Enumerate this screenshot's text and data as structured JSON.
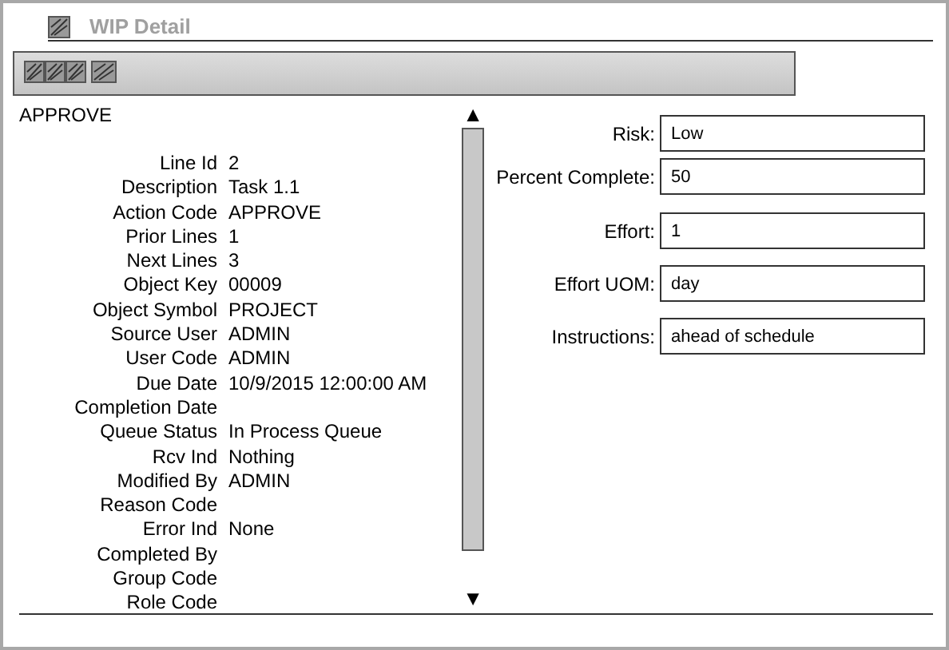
{
  "window": {
    "title": "WIP Detail"
  },
  "heading": "APPROVE",
  "details": [
    {
      "label": "Line Id",
      "value": "2"
    },
    {
      "label": "Description",
      "value": "Task 1.1"
    },
    {
      "label": "Action Code",
      "value": "APPROVE"
    },
    {
      "label": "Prior Lines",
      "value": "1"
    },
    {
      "label": "Next Lines",
      "value": "3"
    },
    {
      "label": "Object Key",
      "value": "00009"
    },
    {
      "label": "Object Symbol",
      "value": "PROJECT"
    },
    {
      "label": "Source User",
      "value": "ADMIN"
    },
    {
      "label": "User Code",
      "value": "ADMIN"
    },
    {
      "label": "Due Date",
      "value": "10/9/2015 12:00:00 AM"
    },
    {
      "label": "Completion Date"
    },
    {
      "label": "Queue Status",
      "value": "In Process Queue"
    },
    {
      "label": "Rcv Ind",
      "value": "Nothing"
    },
    {
      "label": "Modified By",
      "value": "ADMIN"
    },
    {
      "label": "Reason Code"
    },
    {
      "label": "Error Ind",
      "value": "None"
    },
    {
      "label": "Completed By"
    },
    {
      "label": "Group Code"
    },
    {
      "label": "Role Code"
    }
  ],
  "scrollbar": {
    "up": "▲",
    "down": "▼"
  },
  "fields": [
    {
      "label": "Risk:",
      "value": "Low"
    },
    {
      "label": "Percent Complete:",
      "value": "50"
    },
    {
      "label": "Effort:",
      "value": "1"
    },
    {
      "label": "Effort UOM:",
      "value": "day"
    },
    {
      "label": "Instructions:",
      "value": "ahead of schedule"
    }
  ]
}
